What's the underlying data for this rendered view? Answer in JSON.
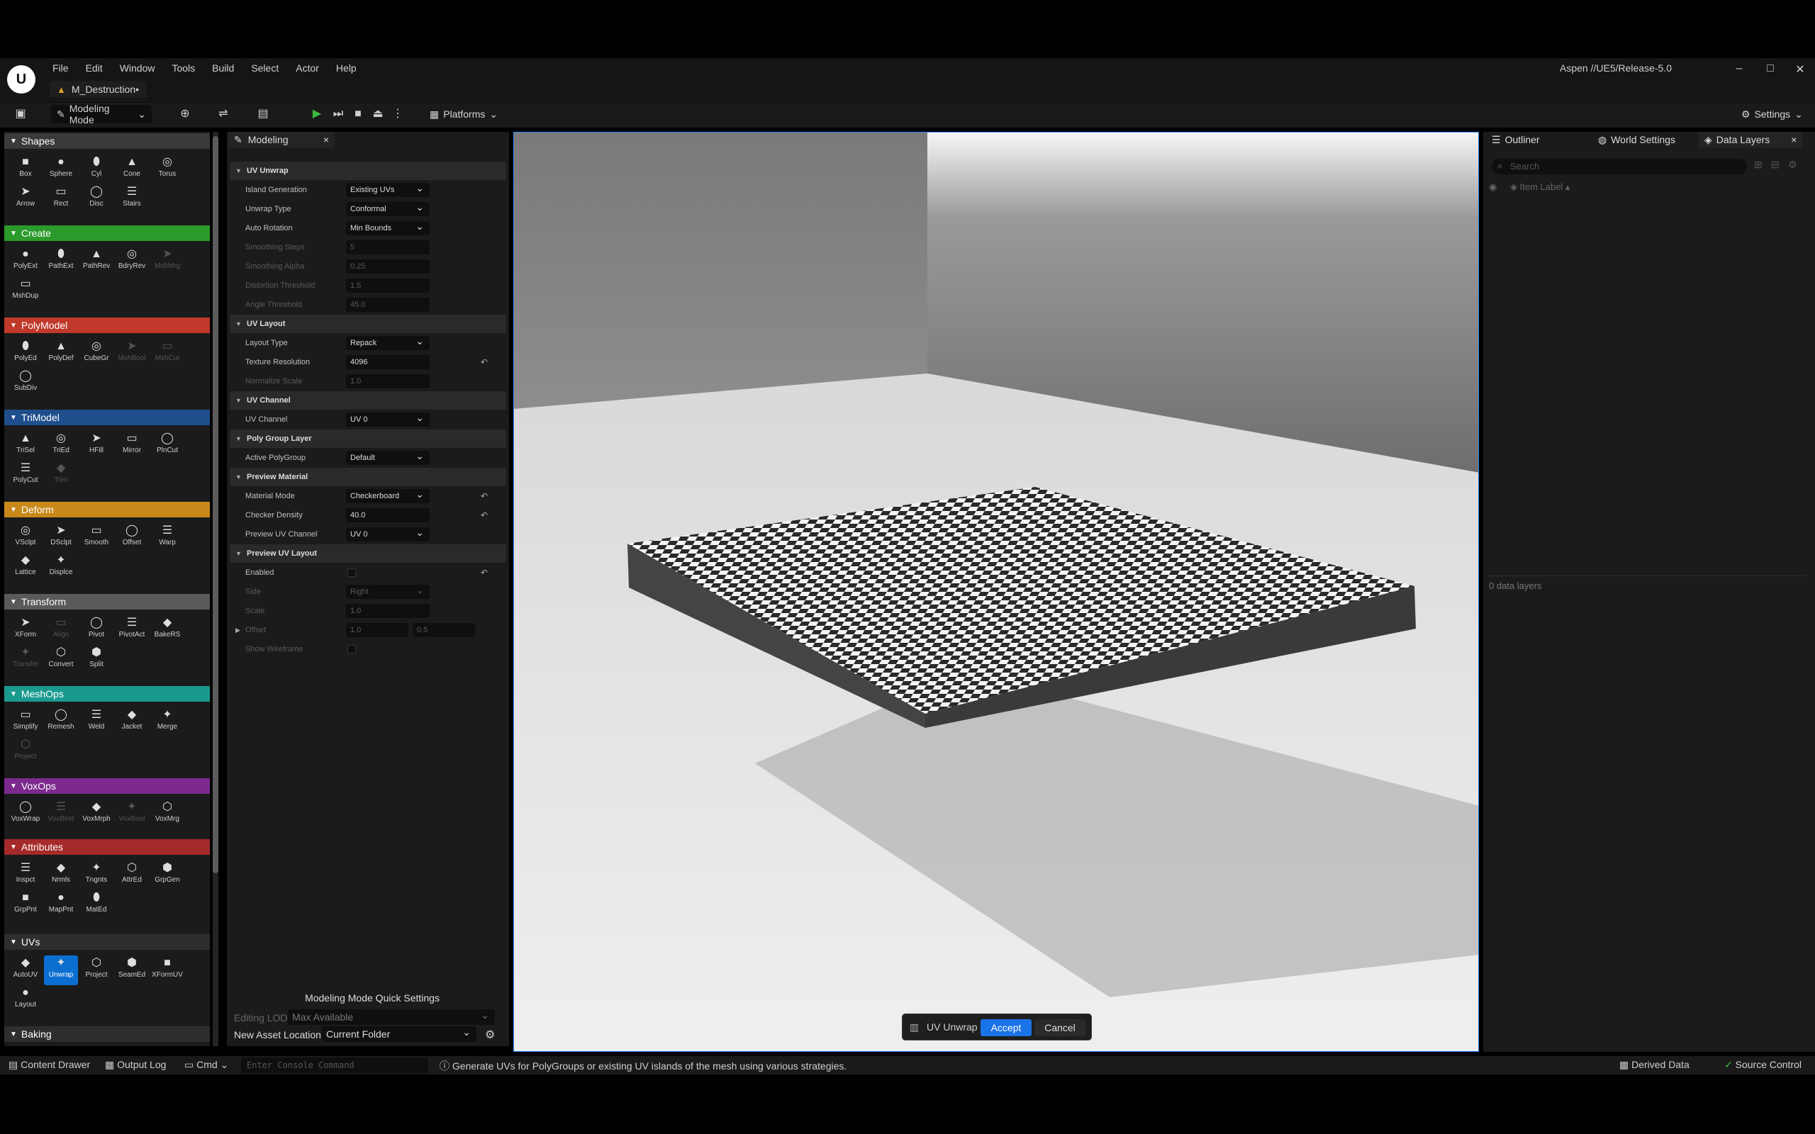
{
  "menu": [
    "File",
    "Edit",
    "Window",
    "Tools",
    "Build",
    "Select",
    "Actor",
    "Help"
  ],
  "doc_tab": "M_Destruction•",
  "branch": "Aspen //UE5/Release-5.0",
  "window_controls": {
    "minimize": "–",
    "maximize": "□",
    "close": "✕"
  },
  "toolbar": {
    "mode": "Modeling Mode",
    "platforms": "Platforms",
    "settings": "Settings"
  },
  "palette": {
    "categories": [
      {
        "name": "Shapes",
        "color": "#3a3a3a",
        "tools": [
          "Box",
          "Sphere",
          "Cyl",
          "Cone",
          "Torus",
          "Arrow",
          "Rect",
          "Disc",
          "Stairs"
        ]
      },
      {
        "name": "Create",
        "color": "#2a9a2a",
        "tools": [
          "PolyExt",
          "PathExt",
          "PathRev",
          "BdryRev",
          "MshMrg",
          "MshDup"
        ]
      },
      {
        "name": "PolyModel",
        "color": "#c0392b",
        "tools": [
          "PolyEd",
          "PolyDef",
          "CubeGr",
          "MshBool",
          "MshCut",
          "SubDiv"
        ]
      },
      {
        "name": "TriModel",
        "color": "#1f4e8c",
        "tools": [
          "TriSel",
          "TriEd",
          "HFill",
          "Mirror",
          "PlnCut",
          "PolyCut",
          "Trim"
        ]
      },
      {
        "name": "Deform",
        "color": "#c8891a",
        "tools": [
          "VSclpt",
          "DSclpt",
          "Smooth",
          "Offset",
          "Warp",
          "Lattice",
          "Displce"
        ]
      },
      {
        "name": "Transform",
        "color": "#5a5a5a",
        "tools": [
          "XForm",
          "Align",
          "Pivot",
          "PivotAct",
          "BakeRS",
          "Transfer",
          "Convert",
          "Split"
        ]
      },
      {
        "name": "MeshOps",
        "color": "#1a9a8f",
        "tools": [
          "Simplify",
          "Remesh",
          "Weld",
          "Jacket",
          "Merge",
          "Project"
        ]
      },
      {
        "name": "VoxOps",
        "color": "#7d2a8f",
        "tools": [
          "VoxWrap",
          "VoxBlnd",
          "VoxMrph",
          "VoxBool",
          "VoxMrg"
        ]
      },
      {
        "name": "Attributes",
        "color": "#a52a2a",
        "tools": [
          "Inspct",
          "Nrmls",
          "Tngnts",
          "AttrEd",
          "GrpGen",
          "GrpPnt",
          "MapPnt",
          "MatEd"
        ]
      },
      {
        "name": "UVs",
        "color": "#2e2e2e",
        "tools": [
          "AutoUV",
          "Unwrap",
          "Project",
          "SeamEd",
          "XFormUV",
          "Layout"
        ]
      },
      {
        "name": "Baking",
        "color": "#2e2e2e",
        "tools": []
      }
    ]
  },
  "modeling_panel": {
    "tab": "Modeling",
    "sections": [
      {
        "header": "UV Unwrap"
      },
      {
        "label": "Island Generation",
        "value": "Existing UVs",
        "type": "dropdown"
      },
      {
        "label": "Unwrap Type",
        "value": "Conformal",
        "type": "dropdown"
      },
      {
        "label": "Auto Rotation",
        "value": "Min Bounds",
        "type": "dropdown"
      },
      {
        "label": "Smoothing Steps",
        "value": "5",
        "type": "disabled"
      },
      {
        "label": "Smoothing Alpha",
        "value": "0.25",
        "type": "disabled"
      },
      {
        "label": "Distortion Threshold",
        "value": "1.5",
        "type": "disabled"
      },
      {
        "label": "Angle Threshold",
        "value": "45.0",
        "type": "disabled"
      },
      {
        "header": "UV Layout"
      },
      {
        "label": "Layout Type",
        "value": "Repack",
        "type": "dropdown"
      },
      {
        "label": "Texture Resolution",
        "value": "4096",
        "type": "number",
        "reset": true
      },
      {
        "label": "Normalize Scale",
        "value": "1.0",
        "type": "disabled"
      },
      {
        "header": "UV Channel"
      },
      {
        "label": "UV Channel",
        "value": "UV 0",
        "type": "dropdown"
      },
      {
        "header": "Poly Group Layer"
      },
      {
        "label": "Active PolyGroup",
        "value": "Default",
        "type": "dropdown"
      },
      {
        "header": "Preview Material"
      },
      {
        "label": "Material Mode",
        "value": "Checkerboard",
        "type": "dropdown",
        "reset": true
      },
      {
        "label": "Checker Density",
        "value": "40.0",
        "type": "number",
        "reset": true
      },
      {
        "label": "Preview UV Channel",
        "value": "UV 0",
        "type": "dropdown"
      },
      {
        "header": "Preview UV Layout"
      },
      {
        "label": "Enabled",
        "value": "",
        "type": "checkbox",
        "reset": true
      },
      {
        "label": "Side",
        "value": "Right",
        "type": "disabled-dd"
      },
      {
        "label": "Scale",
        "value": "1.0",
        "type": "disabled"
      },
      {
        "label": "Offset",
        "value": "1.0",
        "value2": "0.5",
        "type": "disabled2"
      },
      {
        "label": "Show Wireframe",
        "value": "",
        "type": "disabled-check"
      }
    ],
    "quick_settings": {
      "title": "Modeling Mode Quick Settings",
      "editing_lod_label": "Editing LOD",
      "editing_lod_value": "Max Available",
      "new_asset_label": "New Asset Location",
      "new_asset_value": "Current Folder"
    }
  },
  "right_panel": {
    "tabs": [
      "Outliner",
      "World Settings",
      "Data Layers"
    ],
    "search_placeholder": "Search",
    "column": "Item Label",
    "footer": "0 data layers"
  },
  "accept_bar": {
    "tool": "UV Unwrap",
    "accept": "Accept",
    "cancel": "Cancel"
  },
  "statusbar": {
    "content_drawer": "Content Drawer",
    "output_log": "Output Log",
    "cmd": "Cmd",
    "console_placeholder": "Enter Console Command",
    "hint": "Generate UVs for PolyGroups or existing UV islands of the mesh using various strategies.",
    "derived_data": "Derived Data",
    "source_control": "Source Control"
  }
}
